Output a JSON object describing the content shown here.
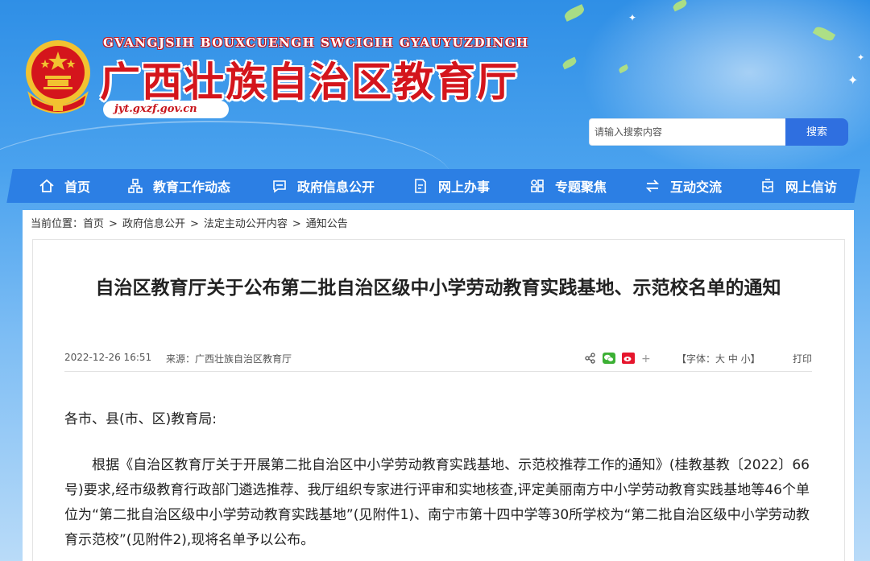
{
  "site": {
    "pinyin": "GVANGJSIH BOUXCUENGH SWCIGIH GYAUYUZDINGH",
    "title": "广西壮族自治区教育厅",
    "domain": "jyt.gxzf.gov.cn"
  },
  "search": {
    "placeholder": "请输入搜索内容",
    "button": "搜索"
  },
  "nav": [
    {
      "label": "首页",
      "icon": "home-icon"
    },
    {
      "label": "教育工作动态",
      "icon": "sitemap-icon"
    },
    {
      "label": "政府信息公开",
      "icon": "chat-icon"
    },
    {
      "label": "网上办事",
      "icon": "edit-icon"
    },
    {
      "label": "专题聚焦",
      "icon": "grid-icon"
    },
    {
      "label": "互动交流",
      "icon": "exchange-icon"
    },
    {
      "label": "网上信访",
      "icon": "inbox-icon"
    }
  ],
  "breadcrumb": {
    "prefix": "当前位置：",
    "items": [
      "首页",
      "政府信息公开",
      "法定主动公开内容",
      "通知公告"
    ],
    "sep": ">"
  },
  "article": {
    "title": "自治区教育厅关于公布第二批自治区级中小学劳动教育实践基地、示范校名单的通知",
    "date": "2022-12-26 16:51",
    "source": "来源：广西壮族自治区教育厅",
    "font_label": "【字体：大 中 小】",
    "print_label": "打印",
    "share_plus": "+",
    "salutation": "各市、县(市、区)教育局:",
    "paragraph": "根据《自治区教育厅关于开展第二批自治区中小学劳动教育实践基地、示范校推荐工作的通知》(桂教基教〔2022〕66号)要求,经市级教育行政部门遴选推荐、我厅组织专家进行评审和实地核查,评定美丽南方中小学劳动教育实践基地等46个单位为“第二批自治区级中小学劳动教育实践基地”(见附件1)、南宁市第十四中学等30所学校为“第二批自治区级中小学劳动教育示范校”(见附件2),现将名单予以公布。"
  },
  "colors": {
    "brand_red": "#d4151c",
    "nav_blue": "#2c7fe4",
    "button_blue": "#2f6fe0"
  }
}
